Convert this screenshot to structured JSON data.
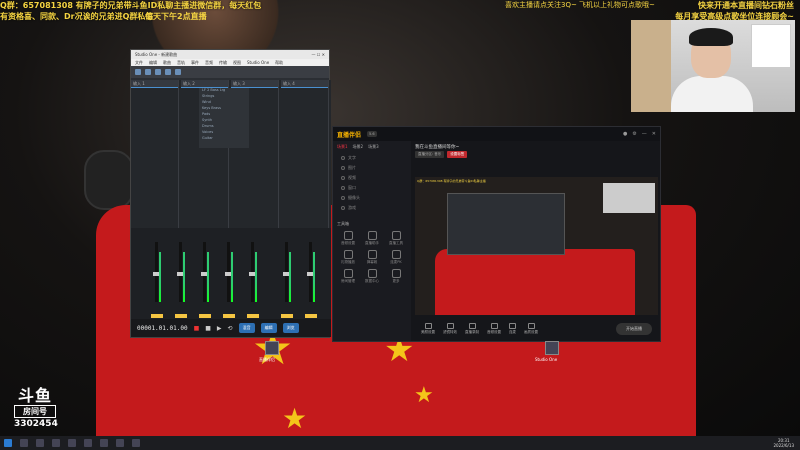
{
  "overlay": {
    "ticker_line1": "Q群：657081308 有牌子的兄弟带斗鱼ID私聊主播进微信群，每天红包",
    "ticker_line2": "有资格喜、同款、Dr况诶的兄弟进Q群私信",
    "countdown": "每天下午2点直播",
    "center_ticker": "喜欢主播请点关注3Q~ 飞机以上礼物可点歌哦~",
    "right_ticker_line1": "快来开通本直播间钻石粉丝",
    "right_ticker_line2": "每月享受高级点歌坐位连接顾会~"
  },
  "logo": {
    "line1": "斗鱼",
    "line2": "房间号",
    "room_number": "3302454"
  },
  "daw": {
    "title": "Studio One - 新建歌曲",
    "menu": [
      "文件",
      "编辑",
      "歌曲",
      "音轨",
      "事件",
      "音频",
      "传输",
      "视图",
      "Studio One",
      "帮助"
    ],
    "track_headers": [
      "输入 1",
      "输入 2",
      "输入 3",
      "输入 4"
    ],
    "browser_items": [
      "LF 2 Bass Lrg",
      "Strings",
      "Wind",
      "Keys Brass",
      "Pads",
      "Synth",
      "Drums",
      "Voices",
      "Guitar"
    ],
    "time": "00001.01.01.00",
    "buttons": {
      "mix": "混音",
      "edit": "编辑",
      "browse": "浏览"
    }
  },
  "companion": {
    "brand": "直播伴侣",
    "version": "5.6",
    "tabs": [
      "场景1",
      "场景2",
      "场景3"
    ],
    "scenes": [
      "文字",
      "图片",
      "视频",
      "窗口",
      "摄像头",
      "游戏"
    ],
    "tools_title": "工具箱",
    "tools": [
      "音频设置",
      "直播助手",
      "直播工具",
      "礼物播放",
      "弹幕姬",
      "连麦PK",
      "房间管理",
      "数据中心",
      "更多"
    ],
    "stream_title": "我在斗鱼直播间等你~",
    "chips": [
      "直播分区: 音乐",
      "设置标签"
    ],
    "preview_caption": "Q群：657081308 有牌子的兄弟带斗鱼ID私聊主播",
    "bottom_tools": [
      "美颜设置",
      "滤镜特效",
      "直播录制",
      "音频设置",
      "连麦",
      "画质设置"
    ],
    "go_live": "开始直播"
  },
  "desktop": {
    "icon1_label": "直播伴侣",
    "icon2_label": "Studio One"
  },
  "taskbar": {
    "time": "20:31",
    "date": "2022/6/13"
  }
}
